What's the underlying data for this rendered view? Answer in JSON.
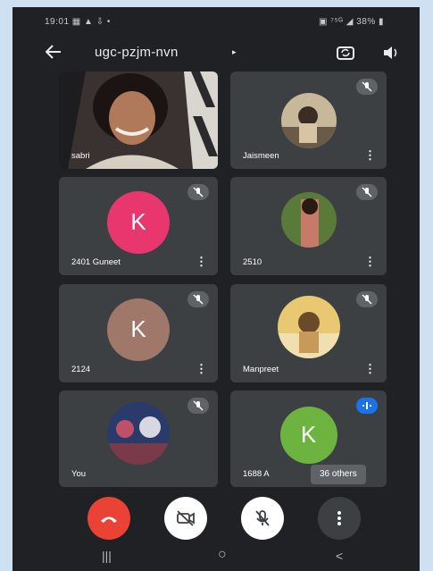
{
  "status_bar": {
    "left": "19:01 ▦ ▲ ⇩ •",
    "right": "▣ ⁷⁵ᴳ ◢ 38% ▮"
  },
  "top_bar": {
    "title": "ugc-pzjm-nvn",
    "title_caret": "▸"
  },
  "tiles": [
    {
      "name": "sabri",
      "type": "video"
    },
    {
      "name": "Jaismeen",
      "type": "photo",
      "muted": true
    },
    {
      "name": "2401 Guneet",
      "type": "initial",
      "initial": "K",
      "color": "#e8366e",
      "muted": true
    },
    {
      "name": "2510",
      "type": "photo",
      "muted": true
    },
    {
      "name": "2124",
      "type": "initial",
      "initial": "K",
      "color": "#a0786a",
      "muted": true
    },
    {
      "name": "Manpreet",
      "type": "photo",
      "muted": true
    },
    {
      "name": "You",
      "type": "photo",
      "muted": true
    },
    {
      "name": "1688 A",
      "type": "initial",
      "initial": "K",
      "color": "#6cb33f",
      "speaking": true
    }
  ],
  "others_chip": "36 others",
  "more_label": "⋮",
  "controls": {
    "end_call_color": "#ea4335",
    "end_call_icon": "end-call-icon",
    "camera_icon": "camera-off-icon",
    "mic_icon": "mic-off-icon",
    "more_icon": "more-vert-icon"
  },
  "nav_bar": {
    "recents": "|||",
    "home": "○",
    "back": "<"
  }
}
